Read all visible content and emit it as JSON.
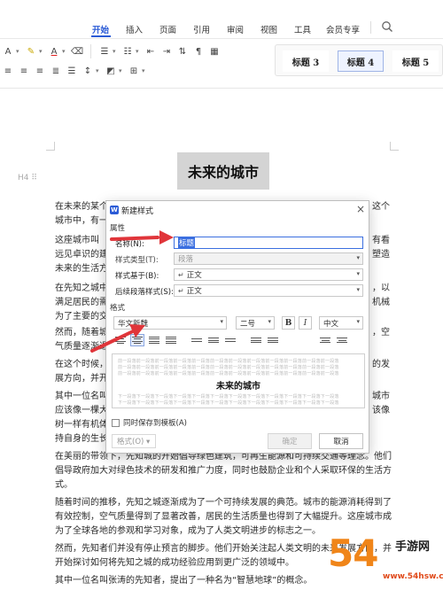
{
  "ribbon": {
    "tabs": [
      "开始",
      "插入",
      "页面",
      "引用",
      "审阅",
      "视图",
      "工具",
      "会员专享"
    ],
    "active_tab": "开始",
    "accent_color": "#2b5bd6"
  },
  "style_gallery": [
    "标题 3",
    "标题 4",
    "标题 5"
  ],
  "document": {
    "heading_marker": "H4",
    "title": "未来的城市",
    "paragraphs_left": [
      "在未来的某个",
      "城市中，有一",
      "这座城市叫",
      "远见卓识的建",
      "未来的生活方",
      "在先知之城中",
      "满足居民的需",
      "为了主要的交",
      "然而，随着城",
      "气质量逐渐退",
      "在这个时候，",
      "展方向，并开",
      "其中一位名叫",
      "应该像一棵大",
      "树一样有机体",
      "持自身的生长",
      "在美丽的带领",
      "倡导政府加大"
    ],
    "paragraphs_right": [
      "这个",
      "有看",
      "塑造",
      "，以",
      "机械",
      "，空",
      "的发",
      "城市",
      "该像",
      "他们"
    ],
    "para_a": "在美丽的带领下，先知城的开始倡导绿色建筑，可再生能源和可持续交通等理念。他们",
    "para_a2": "倡导政府加大对绿色技术的研发和推广力度，同时也鼓励企业和个人采取环保的生活方",
    "para_a3": "式。",
    "para_b1": "随着时间的推移，先知之城逐渐成为了一个可持续发展的典范。城市的能源消耗得到了",
    "para_b2": "有效控制，空气质量得到了显著改善，居民的生活质量也得到了大幅提升。这座城市成",
    "para_b3": "为了全球各地的参观和学习对象，成为了人类文明进步的标志之一。",
    "para_c1": "然而，先知者们并没有停止预言的脚步。他们开始关注起人类文明的未来发展方向，并",
    "para_c2": "开始探讨如何将先知之城的成功经验应用到更广泛的领域中。",
    "para_d1": "其中一位名叫张涛的先知者，提出了一种名为“智慧地球”的概念。"
  },
  "dialog": {
    "title": "新建样式",
    "section_properties": "属性",
    "name_label": "名称(N):",
    "name_value": "标题",
    "style_type_label": "样式类型(T):",
    "style_type_value": "段落",
    "based_on_label": "样式基于(B):",
    "based_on_value": "正文",
    "next_style_label": "后续段落样式(S):",
    "next_style_value": "正文",
    "section_format": "格式",
    "font_value": "华文新魏",
    "size_value": "二号",
    "bold_label": "B",
    "italic_label": "I",
    "script_value": "中文",
    "preview_line": "前一段落前一段落前一段落前一段落前一段落前一段落前一段落前一段落前一段落前一段落前一段落前一段落",
    "preview_sample": "未来的城市",
    "preview_after": "下一段落下一段落下一段落下一段落下一段落下一段落下一段落下一段落下一段落下一段落下一段落下一段落",
    "save_template_label": "同时保存到模板(A)",
    "format_button": "格式(O) ▾",
    "ok_button": "确定",
    "cancel_button": "取消"
  },
  "watermark": {
    "number": "54",
    "brand": "手游网",
    "url": "www.54hsw.com"
  },
  "colors": {
    "arrow": "#e0353a",
    "selection": "#3b6fe0",
    "watermark_orange": "#f08519"
  }
}
